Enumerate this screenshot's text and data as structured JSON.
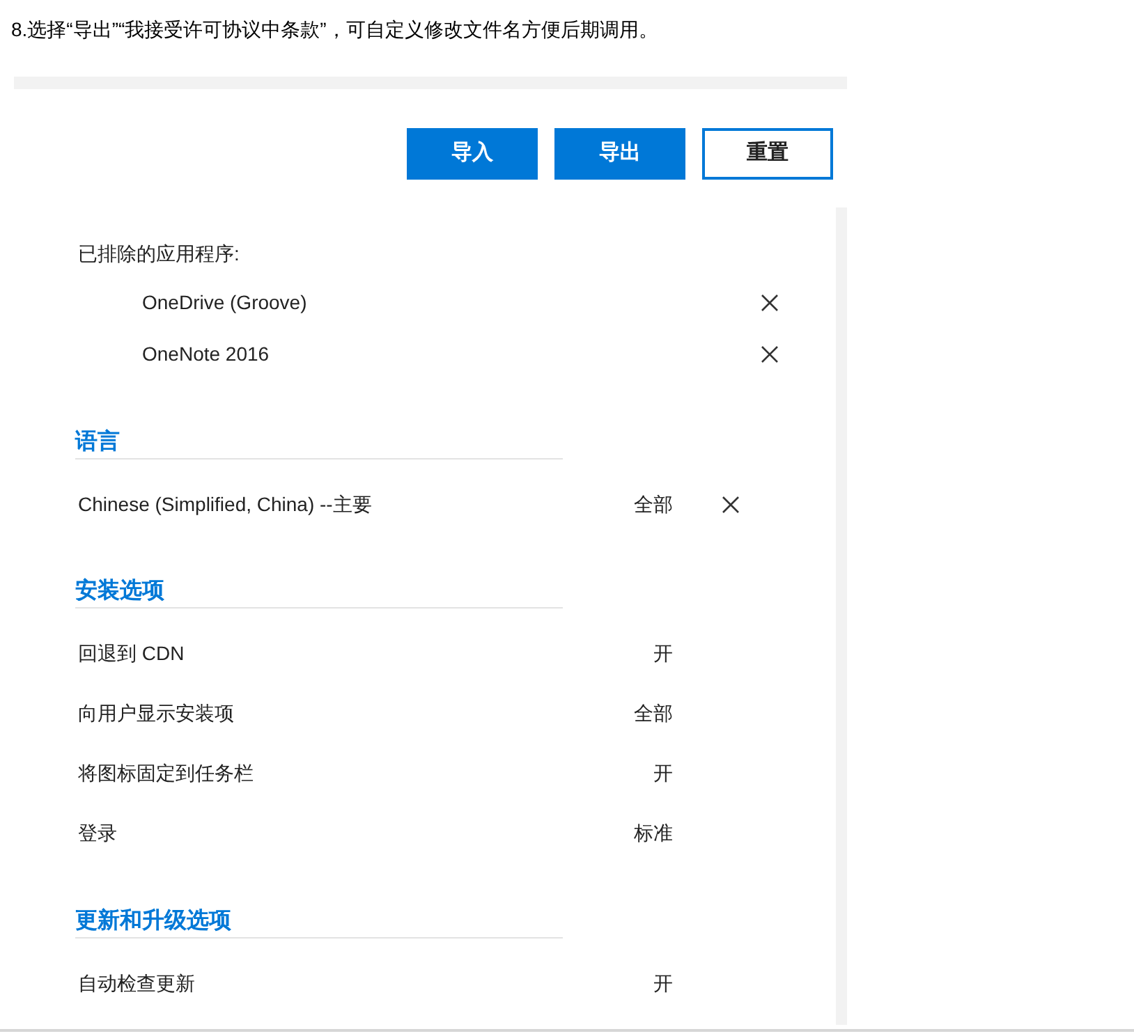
{
  "caption": "8.选择“导出”“我接受许可协议中条款”，可自定义修改文件名方便后期调用。",
  "buttons": [
    {
      "label": "导入",
      "kind": "primary"
    },
    {
      "label": "导出",
      "kind": "primary"
    },
    {
      "label": "重置",
      "kind": "outline"
    }
  ],
  "excluded_apps": {
    "label": "已排除的应用程序:",
    "items": [
      {
        "name": "OneDrive (Groove)",
        "removable": true
      },
      {
        "name": "OneNote 2016",
        "removable": true
      }
    ]
  },
  "sections": [
    {
      "title": "语言",
      "rows": [
        {
          "label": "Chinese (Simplified, China) --主要",
          "value": "全部",
          "removable": true
        }
      ]
    },
    {
      "title": "安装选项",
      "rows": [
        {
          "label": "回退到 CDN",
          "value": "开",
          "removable": false
        },
        {
          "label": "向用户显示安装项",
          "value": "全部",
          "removable": false
        },
        {
          "label": "将图标固定到任务栏",
          "value": "开",
          "removable": false
        },
        {
          "label": "登录",
          "value": "标准",
          "removable": false
        }
      ]
    },
    {
      "title": "更新和升级选项",
      "rows": [
        {
          "label": "自动检查更新",
          "value": "开",
          "removable": false
        }
      ]
    }
  ]
}
